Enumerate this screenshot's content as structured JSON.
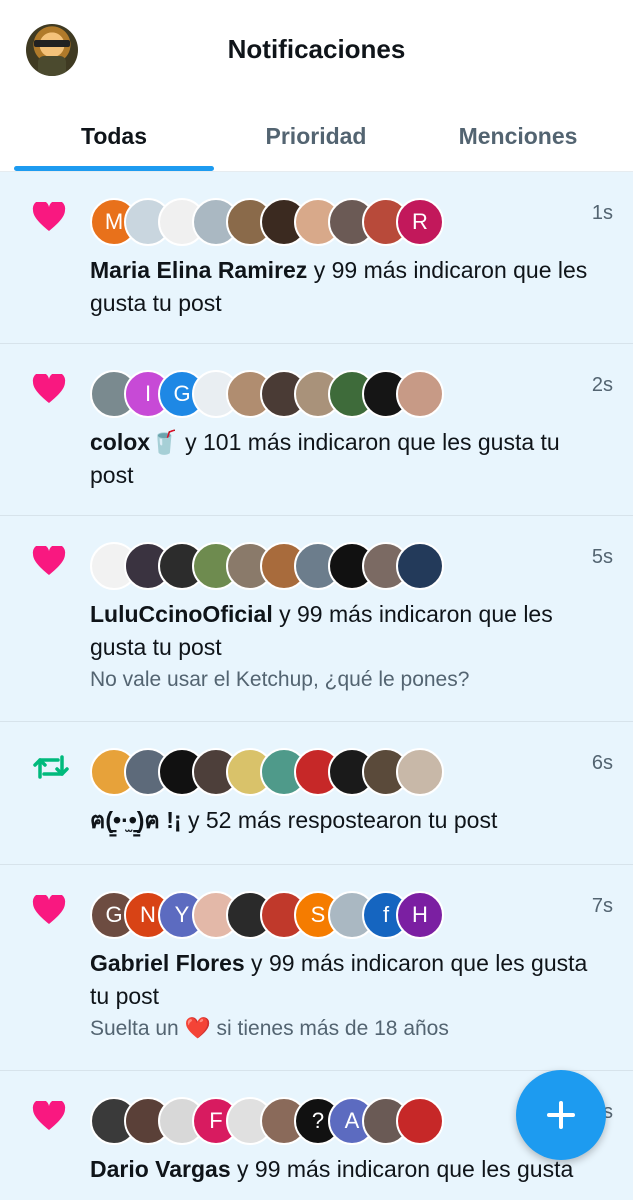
{
  "header": {
    "title": "Notificaciones",
    "avatar_icon": "soldier-avatar"
  },
  "tabs": [
    {
      "label": "Todas",
      "active": true
    },
    {
      "label": "Prioridad",
      "active": false
    },
    {
      "label": "Menciones",
      "active": false
    }
  ],
  "notifications": [
    {
      "kind": "like",
      "time": "1s",
      "avatars": [
        {
          "letter": "M",
          "color": "#e8711b"
        },
        {
          "letter": "",
          "color": "#c9d6df"
        },
        {
          "letter": "",
          "color": "#f0f0f0"
        },
        {
          "letter": "",
          "color": "#aab8c2"
        },
        {
          "letter": "",
          "color": "#8a6a4a"
        },
        {
          "letter": "",
          "color": "#3b2a20"
        },
        {
          "letter": "",
          "color": "#d8a98a"
        },
        {
          "letter": "",
          "color": "#6b5a55"
        },
        {
          "letter": "",
          "color": "#b84a3a"
        },
        {
          "letter": "R",
          "color": "#c2185b"
        }
      ],
      "name": "Maria Elina Ramirez",
      "action": " y 99 más indicaron que les gusta tu post",
      "preview": ""
    },
    {
      "kind": "like",
      "time": "2s",
      "avatars": [
        {
          "letter": "",
          "color": "#7a8a8f"
        },
        {
          "letter": "I",
          "color": "#c74ad6"
        },
        {
          "letter": "G",
          "color": "#1e88e5"
        },
        {
          "letter": "",
          "color": "#e9eef2"
        },
        {
          "letter": "",
          "color": "#b08d70"
        },
        {
          "letter": "",
          "color": "#4a3b35"
        },
        {
          "letter": "",
          "color": "#a9927a"
        },
        {
          "letter": "",
          "color": "#3e6b3a"
        },
        {
          "letter": "",
          "color": "#151515"
        },
        {
          "letter": "",
          "color": "#c79a86"
        }
      ],
      "name": "colox🥤",
      "action": " y 101 más indicaron que les gusta tu post",
      "preview": ""
    },
    {
      "kind": "like",
      "time": "5s",
      "avatars": [
        {
          "letter": "",
          "color": "#f2f2f2"
        },
        {
          "letter": "",
          "color": "#3a3340"
        },
        {
          "letter": "",
          "color": "#2c2c2c"
        },
        {
          "letter": "",
          "color": "#6e8b4f"
        },
        {
          "letter": "",
          "color": "#8a7a6a"
        },
        {
          "letter": "",
          "color": "#a86b3c"
        },
        {
          "letter": "",
          "color": "#6c7d8c"
        },
        {
          "letter": "",
          "color": "#111111"
        },
        {
          "letter": "",
          "color": "#7b6a63"
        },
        {
          "letter": "",
          "color": "#233a5a"
        }
      ],
      "name": "LuluCcinoOficial",
      "action": " y 99 más indicaron que les gusta tu post",
      "preview": "No vale usar el Ketchup, ¿qué le pones?"
    },
    {
      "kind": "repost",
      "time": "6s",
      "avatars": [
        {
          "letter": "",
          "color": "#e7a23a"
        },
        {
          "letter": "",
          "color": "#5d6a7a"
        },
        {
          "letter": "",
          "color": "#111111"
        },
        {
          "letter": "",
          "color": "#4d3f3a"
        },
        {
          "letter": "",
          "color": "#d9c26a"
        },
        {
          "letter": "",
          "color": "#4f9a8a"
        },
        {
          "letter": "",
          "color": "#c62828"
        },
        {
          "letter": "",
          "color": "#1a1a1a"
        },
        {
          "letter": "",
          "color": "#5a4a3a"
        },
        {
          "letter": "",
          "color": "#c8b8a8"
        }
      ],
      "name": "ฅ(̳•·̫•̳)ฅ !¡",
      "action": " y 52 más respostearon tu post",
      "preview": ""
    },
    {
      "kind": "like",
      "time": "7s",
      "avatars": [
        {
          "letter": "G",
          "color": "#6d4c41"
        },
        {
          "letter": "N",
          "color": "#d84315"
        },
        {
          "letter": "Y",
          "color": "#5c6bc0"
        },
        {
          "letter": "",
          "color": "#e3b8a8"
        },
        {
          "letter": "",
          "color": "#2a2a2a"
        },
        {
          "letter": "",
          "color": "#c0392b"
        },
        {
          "letter": "S",
          "color": "#f57c00"
        },
        {
          "letter": "",
          "color": "#aab8c2"
        },
        {
          "letter": "f",
          "color": "#1565c0"
        },
        {
          "letter": "H",
          "color": "#7b1fa2"
        }
      ],
      "name": "Gabriel Flores",
      "action": " y 99 más indicaron que les gusta tu post",
      "preview": "Suelta un ❤️ si tienes más de 18 años"
    },
    {
      "kind": "like",
      "time": "8s",
      "avatars": [
        {
          "letter": "",
          "color": "#3a3a3a"
        },
        {
          "letter": "",
          "color": "#5a4038"
        },
        {
          "letter": "",
          "color": "#d8d8d8"
        },
        {
          "letter": "F",
          "color": "#d81b60"
        },
        {
          "letter": "",
          "color": "#e0e0e0"
        },
        {
          "letter": "",
          "color": "#8a6a5a"
        },
        {
          "letter": "?",
          "color": "#111111"
        },
        {
          "letter": "A",
          "color": "#5c6bc0"
        },
        {
          "letter": "",
          "color": "#6a5a55"
        },
        {
          "letter": "",
          "color": "#c62828"
        }
      ],
      "name": "Dario Vargas",
      "action": " y 99 más indicaron que les gusta",
      "preview": ""
    }
  ],
  "fab": {
    "icon": "plus-icon"
  },
  "colors": {
    "accent": "#1d9bf0",
    "like": "#f91880",
    "repost": "#00ba7c",
    "unread_bg": "#e8f5fd"
  }
}
